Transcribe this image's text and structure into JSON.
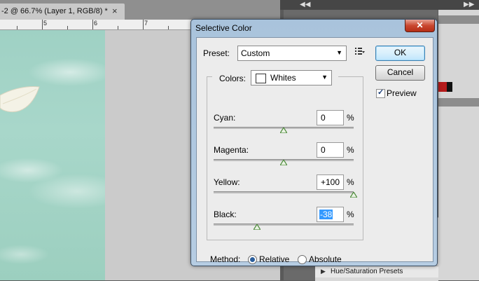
{
  "document": {
    "tab_title": "-2 @ 66.7% (Layer 1, RGB/8) *",
    "tab_close": "×",
    "ruler_numbers": [
      "5",
      "6",
      "7"
    ]
  },
  "panels": {
    "collapse_glyph": "◀◀",
    "expand_glyph": "▶▶",
    "hue_preset_label": "Hue/Saturation Presets",
    "hue_preset_toggle": "▶"
  },
  "dialog": {
    "title": "Selective Color",
    "close_glyph": "✕",
    "preset": {
      "label": "Preset:",
      "value": "Custom",
      "caret": "▼"
    },
    "buttons": {
      "ok": "OK",
      "cancel": "Cancel"
    },
    "preview": {
      "label": "Preview",
      "checked": true,
      "mark": "✓"
    },
    "colors": {
      "label": "Colors:",
      "value": "Whites",
      "caret": "▼"
    },
    "sliders": [
      {
        "name": "Cyan",
        "label": "Cyan:",
        "value": "0",
        "unit": "%",
        "level": 0,
        "selected": false
      },
      {
        "name": "Magenta",
        "label": "Magenta:",
        "value": "0",
        "unit": "%",
        "level": 0,
        "selected": false
      },
      {
        "name": "Yellow",
        "label": "Yellow:",
        "value": "+100",
        "unit": "%",
        "level": 100,
        "selected": false
      },
      {
        "name": "Black",
        "label": "Black:",
        "value": "-38",
        "unit": "%",
        "level": -38,
        "selected": true
      }
    ],
    "method": {
      "label": "Method:",
      "options": [
        {
          "label": "Relative",
          "checked": true
        },
        {
          "label": "Absolute",
          "checked": false
        }
      ]
    }
  },
  "colors": {
    "accent": "#3399ff",
    "slider_thumb": "#4c8a3a",
    "close_button": "#c9472f"
  }
}
